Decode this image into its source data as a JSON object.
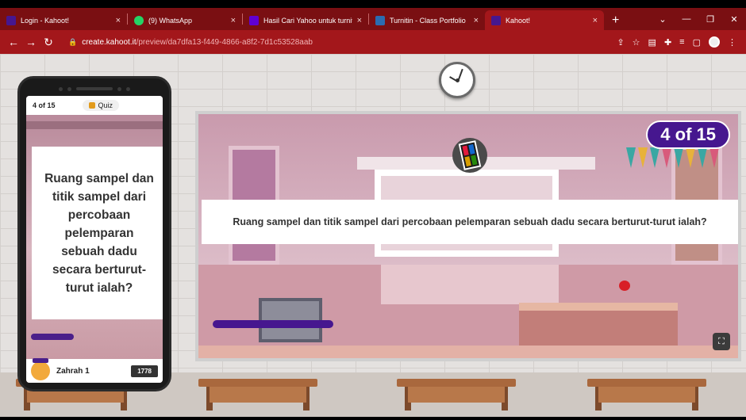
{
  "browser": {
    "tabs": [
      {
        "label": "Login - Kahoot!",
        "close": "×",
        "favicon_color": "#46178f"
      },
      {
        "label": "(9) WhatsApp",
        "close": "×",
        "favicon_color": "#25d366"
      },
      {
        "label": "Hasil Cari Yahoo untuk turnit",
        "close": "×",
        "favicon_color": "#6001d2"
      },
      {
        "label": "Turnitin - Class Portfolio",
        "close": "×",
        "favicon_color": "#2b6cb0"
      },
      {
        "label": "Kahoot!",
        "close": "×",
        "favicon_color": "#46178f"
      }
    ],
    "new_tab": "+",
    "url_host": "create.kahoot.it",
    "url_path": "/preview/da7dfa13-f449-4866-a8f2-7d1c53528aab"
  },
  "phone": {
    "progress": "4 of 15",
    "quiz_label": "Quiz",
    "question": "Ruang sampel dan titik sampel dari percobaan pelemparan sebuah dadu secara berturut-turut ialah?",
    "player_name": "Zahrah 1",
    "score": "1778"
  },
  "stage": {
    "counter": "4 of 15",
    "question": "Ruang sampel dan titik sampel dari percobaan pelemparan sebuah dadu secara berturut-turut ialah?"
  },
  "colors": {
    "kahoot_purple": "#46178f",
    "browser_red": "#a3171b"
  }
}
